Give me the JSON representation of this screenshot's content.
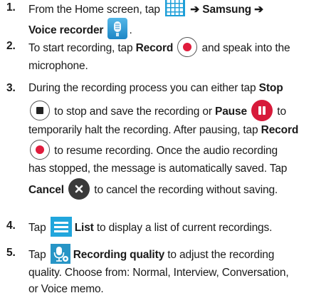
{
  "steps": [
    {
      "number": "1.",
      "l1a": "From the Home screen, tap",
      "arrow1": "➔",
      "l1b": "Samsung",
      "arrow2": "➔",
      "l2a": "Voice recorder",
      "l2b": "."
    },
    {
      "number": "2.",
      "l1a": "To start recording, tap",
      "l1b": "Record",
      "l1c": "and speak into the",
      "l2": "microphone."
    },
    {
      "number": "3.",
      "l1a": "During the recording process you can either tap",
      "l1b": "Stop",
      "l2a": "to stop and save the recording or",
      "l2b": "Pause",
      "l2c": "to",
      "l3a": "temporarily halt the recording. After pausing, tap",
      "l3b": "Record",
      "l4": "to resume recording. Once the audio recording",
      "l5": "has stopped, the message is automatically saved. Tap",
      "l6a": "Cancel",
      "l6b": "to cancel the recording without saving."
    },
    {
      "number": "4.",
      "l1a": "Tap",
      "l1b": "List",
      "l1c": "to display a list of current recordings."
    },
    {
      "number": "5.",
      "l1a": "Tap",
      "l1b": "Recording quality",
      "l1c": "to adjust the recording",
      "l2": "quality. Choose from: Normal, Interview, Conversation,",
      "l3": "or Voice memo."
    }
  ],
  "icons": {
    "apps": "apps-grid-icon",
    "voice_recorder": "voice-recorder-app-icon",
    "record": "record-icon",
    "stop": "stop-icon",
    "pause": "pause-icon",
    "cancel": "cancel-icon",
    "list": "list-icon",
    "recording_quality": "recording-quality-icon"
  },
  "colors": {
    "record_red": "#e01b3c",
    "pause_red": "#d71a3a",
    "blue": "#21a6dc",
    "cancel_dark": "#3a3a3a"
  }
}
